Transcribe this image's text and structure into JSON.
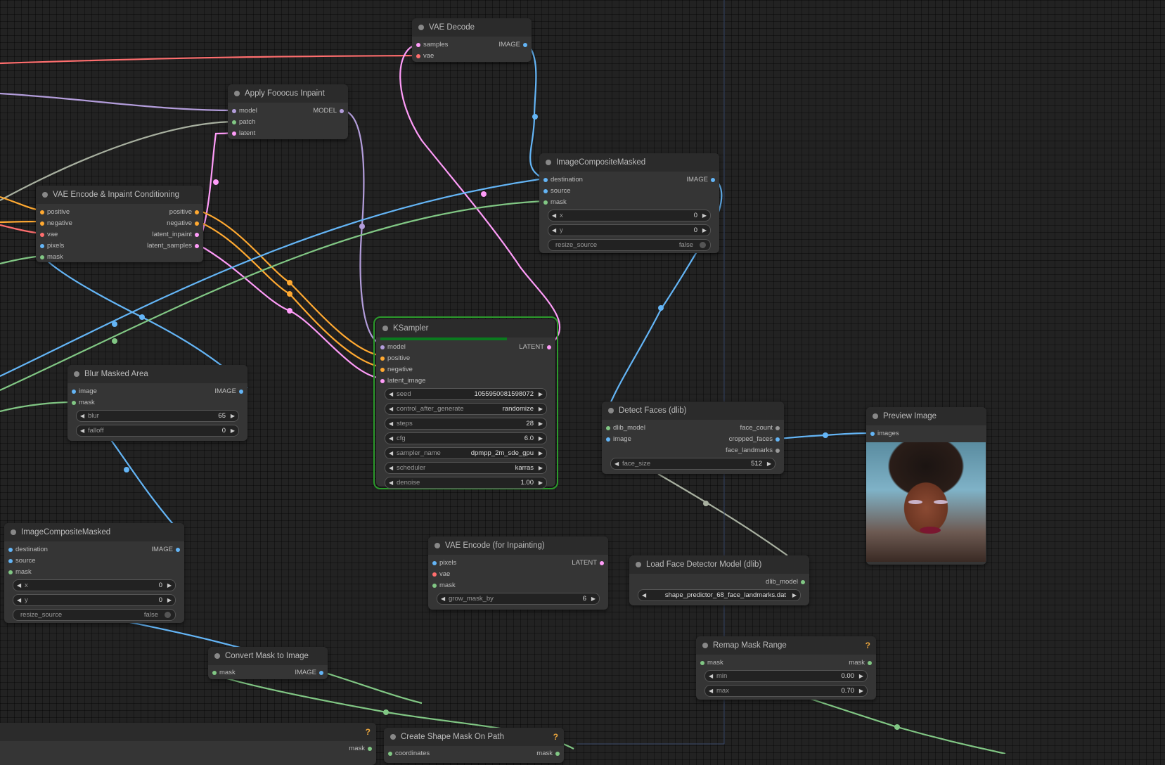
{
  "colors": {
    "canvas": "#222222",
    "model": "#b39ddb",
    "conditioning": "#ffa931",
    "vae": "#ff6e6e",
    "image": "#64b5f6",
    "mask": "#81c784",
    "latent": "#ff9cf9",
    "clip": "#a8b0a0"
  },
  "nodes": {
    "vae_decode": {
      "title": "VAE Decode",
      "in": [
        "samples",
        "vae"
      ],
      "out": [
        "IMAGE"
      ]
    },
    "apply_fooocus": {
      "title": "Apply Fooocus Inpaint",
      "in": [
        "model",
        "patch",
        "latent"
      ],
      "out": [
        "MODEL"
      ]
    },
    "vae_encode_inpaint": {
      "title": "VAE Encode & Inpaint Conditioning",
      "in": [
        "positive",
        "negative",
        "vae",
        "pixels",
        "mask"
      ],
      "out": [
        "positive",
        "negative",
        "latent_inpaint",
        "latent_samples"
      ]
    },
    "image_composite_1": {
      "title": "ImageCompositeMasked",
      "in": [
        "destination",
        "source",
        "mask"
      ],
      "out": [
        "IMAGE"
      ],
      "widgets": [
        {
          "name": "x",
          "value": "0"
        },
        {
          "name": "y",
          "value": "0"
        }
      ],
      "toggle": {
        "name": "resize_source",
        "value": "false"
      }
    },
    "ksampler": {
      "title": "KSampler",
      "in": [
        "model",
        "positive",
        "negative",
        "latent_image"
      ],
      "out": [
        "LATENT"
      ],
      "widgets": [
        {
          "name": "seed",
          "value": "1055950081598072"
        },
        {
          "name": "control_after_generate",
          "value": "randomize"
        },
        {
          "name": "steps",
          "value": "28"
        },
        {
          "name": "cfg",
          "value": "6.0"
        },
        {
          "name": "sampler_name",
          "value": "dpmpp_2m_sde_gpu"
        },
        {
          "name": "scheduler",
          "value": "karras"
        },
        {
          "name": "denoise",
          "value": "1.00"
        }
      ]
    },
    "blur_masked": {
      "title": "Blur Masked Area",
      "in": [
        "image",
        "mask"
      ],
      "out": [
        "IMAGE"
      ],
      "widgets": [
        {
          "name": "blur",
          "value": "65"
        },
        {
          "name": "falloff",
          "value": "0"
        }
      ]
    },
    "detect_faces": {
      "title": "Detect Faces (dlib)",
      "in": [
        "dlib_model",
        "image"
      ],
      "out": [
        "face_count",
        "cropped_faces",
        "face_landmarks"
      ],
      "widgets": [
        {
          "name": "face_size",
          "value": "512"
        }
      ]
    },
    "preview_image": {
      "title": "Preview Image",
      "in": [
        "images"
      ]
    },
    "image_composite_2": {
      "title": "ImageCompositeMasked",
      "in": [
        "destination",
        "source",
        "mask"
      ],
      "out": [
        "IMAGE"
      ],
      "widgets": [
        {
          "name": "x",
          "value": "0"
        },
        {
          "name": "y",
          "value": "0"
        }
      ],
      "toggle": {
        "name": "resize_source",
        "value": "false"
      }
    },
    "vae_encode_for_inpaint": {
      "title": "VAE Encode (for Inpainting)",
      "in": [
        "pixels",
        "vae",
        "mask"
      ],
      "out": [
        "LATENT"
      ],
      "widgets": [
        {
          "name": "grow_mask_by",
          "value": "6"
        }
      ]
    },
    "load_face_detector": {
      "title": "Load Face Detector Model (dlib)",
      "out": [
        "dlib_model"
      ],
      "widgets": [
        {
          "name": "shape_predictor_68_face_landmarks.dat",
          "value": "shape_predictor_68_face_landmarks.dat"
        }
      ]
    },
    "remap_mask": {
      "title": "Remap Mask Range",
      "badge": "?",
      "in": [
        "mask"
      ],
      "out": [
        "mask"
      ],
      "widgets": [
        {
          "name": "min",
          "value": "0.00"
        },
        {
          "name": "max",
          "value": "0.70"
        }
      ]
    },
    "convert_mask": {
      "title": "Convert Mask to Image",
      "in": [
        "mask"
      ],
      "out": [
        "IMAGE"
      ]
    },
    "create_shape_mask": {
      "title": "Create Shape Mask On Path",
      "badge": "?",
      "in": [
        "coordinates"
      ],
      "out": [
        "mask"
      ]
    },
    "partial_bottom_left": {
      "badge": "?",
      "out": [
        "mask"
      ]
    }
  }
}
